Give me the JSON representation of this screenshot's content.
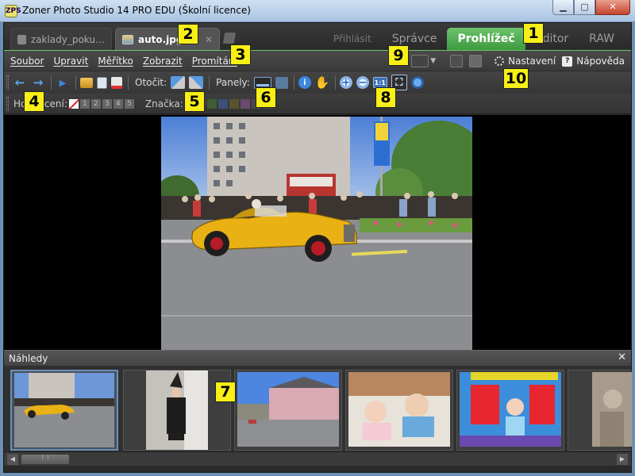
{
  "window": {
    "title": "Zoner Photo Studio 14 PRO EDU (Školní licence)",
    "app_icon": "ZPS"
  },
  "doc_tabs": [
    {
      "label": "zaklady_poku…",
      "active": false
    },
    {
      "label": "auto.jpg",
      "active": true
    }
  ],
  "mode_tabs": {
    "login": "Přihlásit",
    "manager": "Správce",
    "viewer": "Prohlížeč",
    "editor": "Editor",
    "raw": "RAW"
  },
  "menu": {
    "items": [
      "Soubor",
      "Upravit",
      "Měřítko",
      "Zobrazit",
      "Promítání"
    ],
    "settings": "Nastavení",
    "help": "Nápověda",
    "help_badge": "?"
  },
  "toolbar": {
    "rotate_label": "Otočit:",
    "panels_label": "Panely:",
    "fit_1_1": "1:1",
    "zoom_in": "+",
    "zoom_out": "−"
  },
  "ratingbar": {
    "rating_label": "Hodnocení:",
    "rating_numbers": [
      "1",
      "2",
      "3",
      "4",
      "5"
    ],
    "label_label": "Značka:",
    "label_colors": [
      "#6a3535",
      "#3e5e33",
      "#3f4f7a",
      "#5a5230",
      "#6a4a6e",
      "#4a4a4a",
      "#4a4a4a"
    ]
  },
  "thumbnails": {
    "title": "Náhledy",
    "close": "✕",
    "count": 6,
    "selected_index": 0
  },
  "scrollbar": {
    "left": "◀",
    "right": "▶"
  },
  "callouts": [
    "1",
    "2",
    "3",
    "4",
    "5",
    "6",
    "7",
    "8",
    "9",
    "10"
  ],
  "colors": {
    "accent_green": "#4caf50",
    "frame_dark": "#2b2b2b",
    "callout_yellow": "#f7ef16"
  }
}
